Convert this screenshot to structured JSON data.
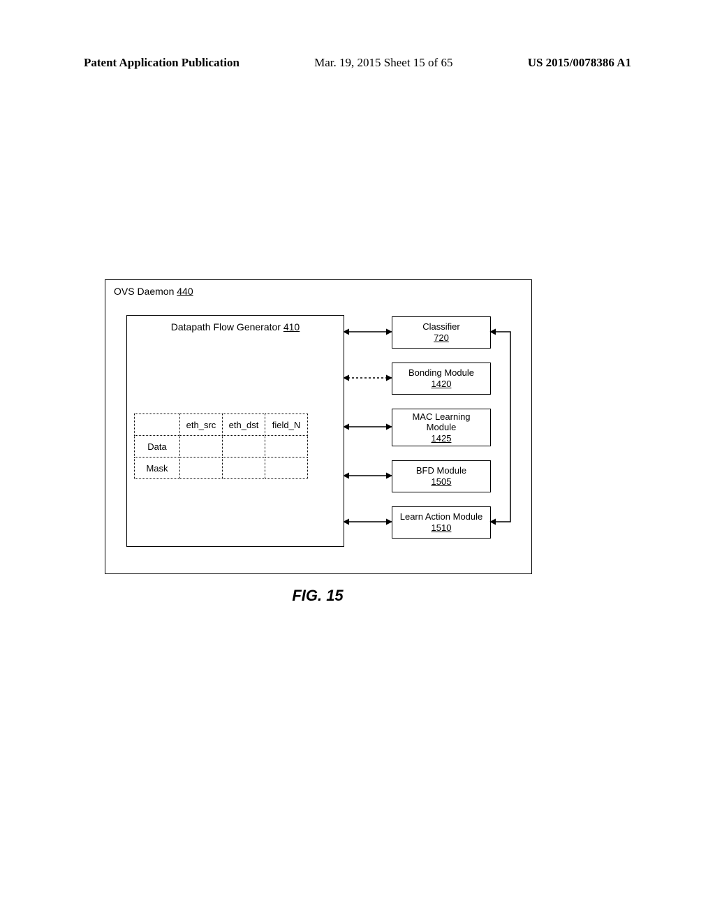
{
  "header": {
    "left": "Patent Application Publication",
    "mid": "Mar. 19, 2015  Sheet 15 of 65",
    "right": "US 2015/0078386 A1"
  },
  "ovs": {
    "label": "OVS Daemon",
    "num": "440"
  },
  "dfg": {
    "title": "Datapath Flow Generator",
    "num": "410"
  },
  "table": {
    "cols": [
      "eth_src",
      "eth_dst",
      "field_N"
    ],
    "rows": [
      "Data",
      "Mask"
    ]
  },
  "modules": {
    "classifier": {
      "name": "Classifier",
      "num": "720"
    },
    "bonding": {
      "name": "Bonding Module",
      "num": "1420"
    },
    "mac": {
      "name1": "MAC Learning",
      "name2": "Module",
      "num": "1425"
    },
    "bfd": {
      "name": "BFD Module",
      "num": "1505"
    },
    "learn": {
      "name": "Learn Action Module",
      "num": "1510"
    }
  },
  "caption": "FIG. 15"
}
